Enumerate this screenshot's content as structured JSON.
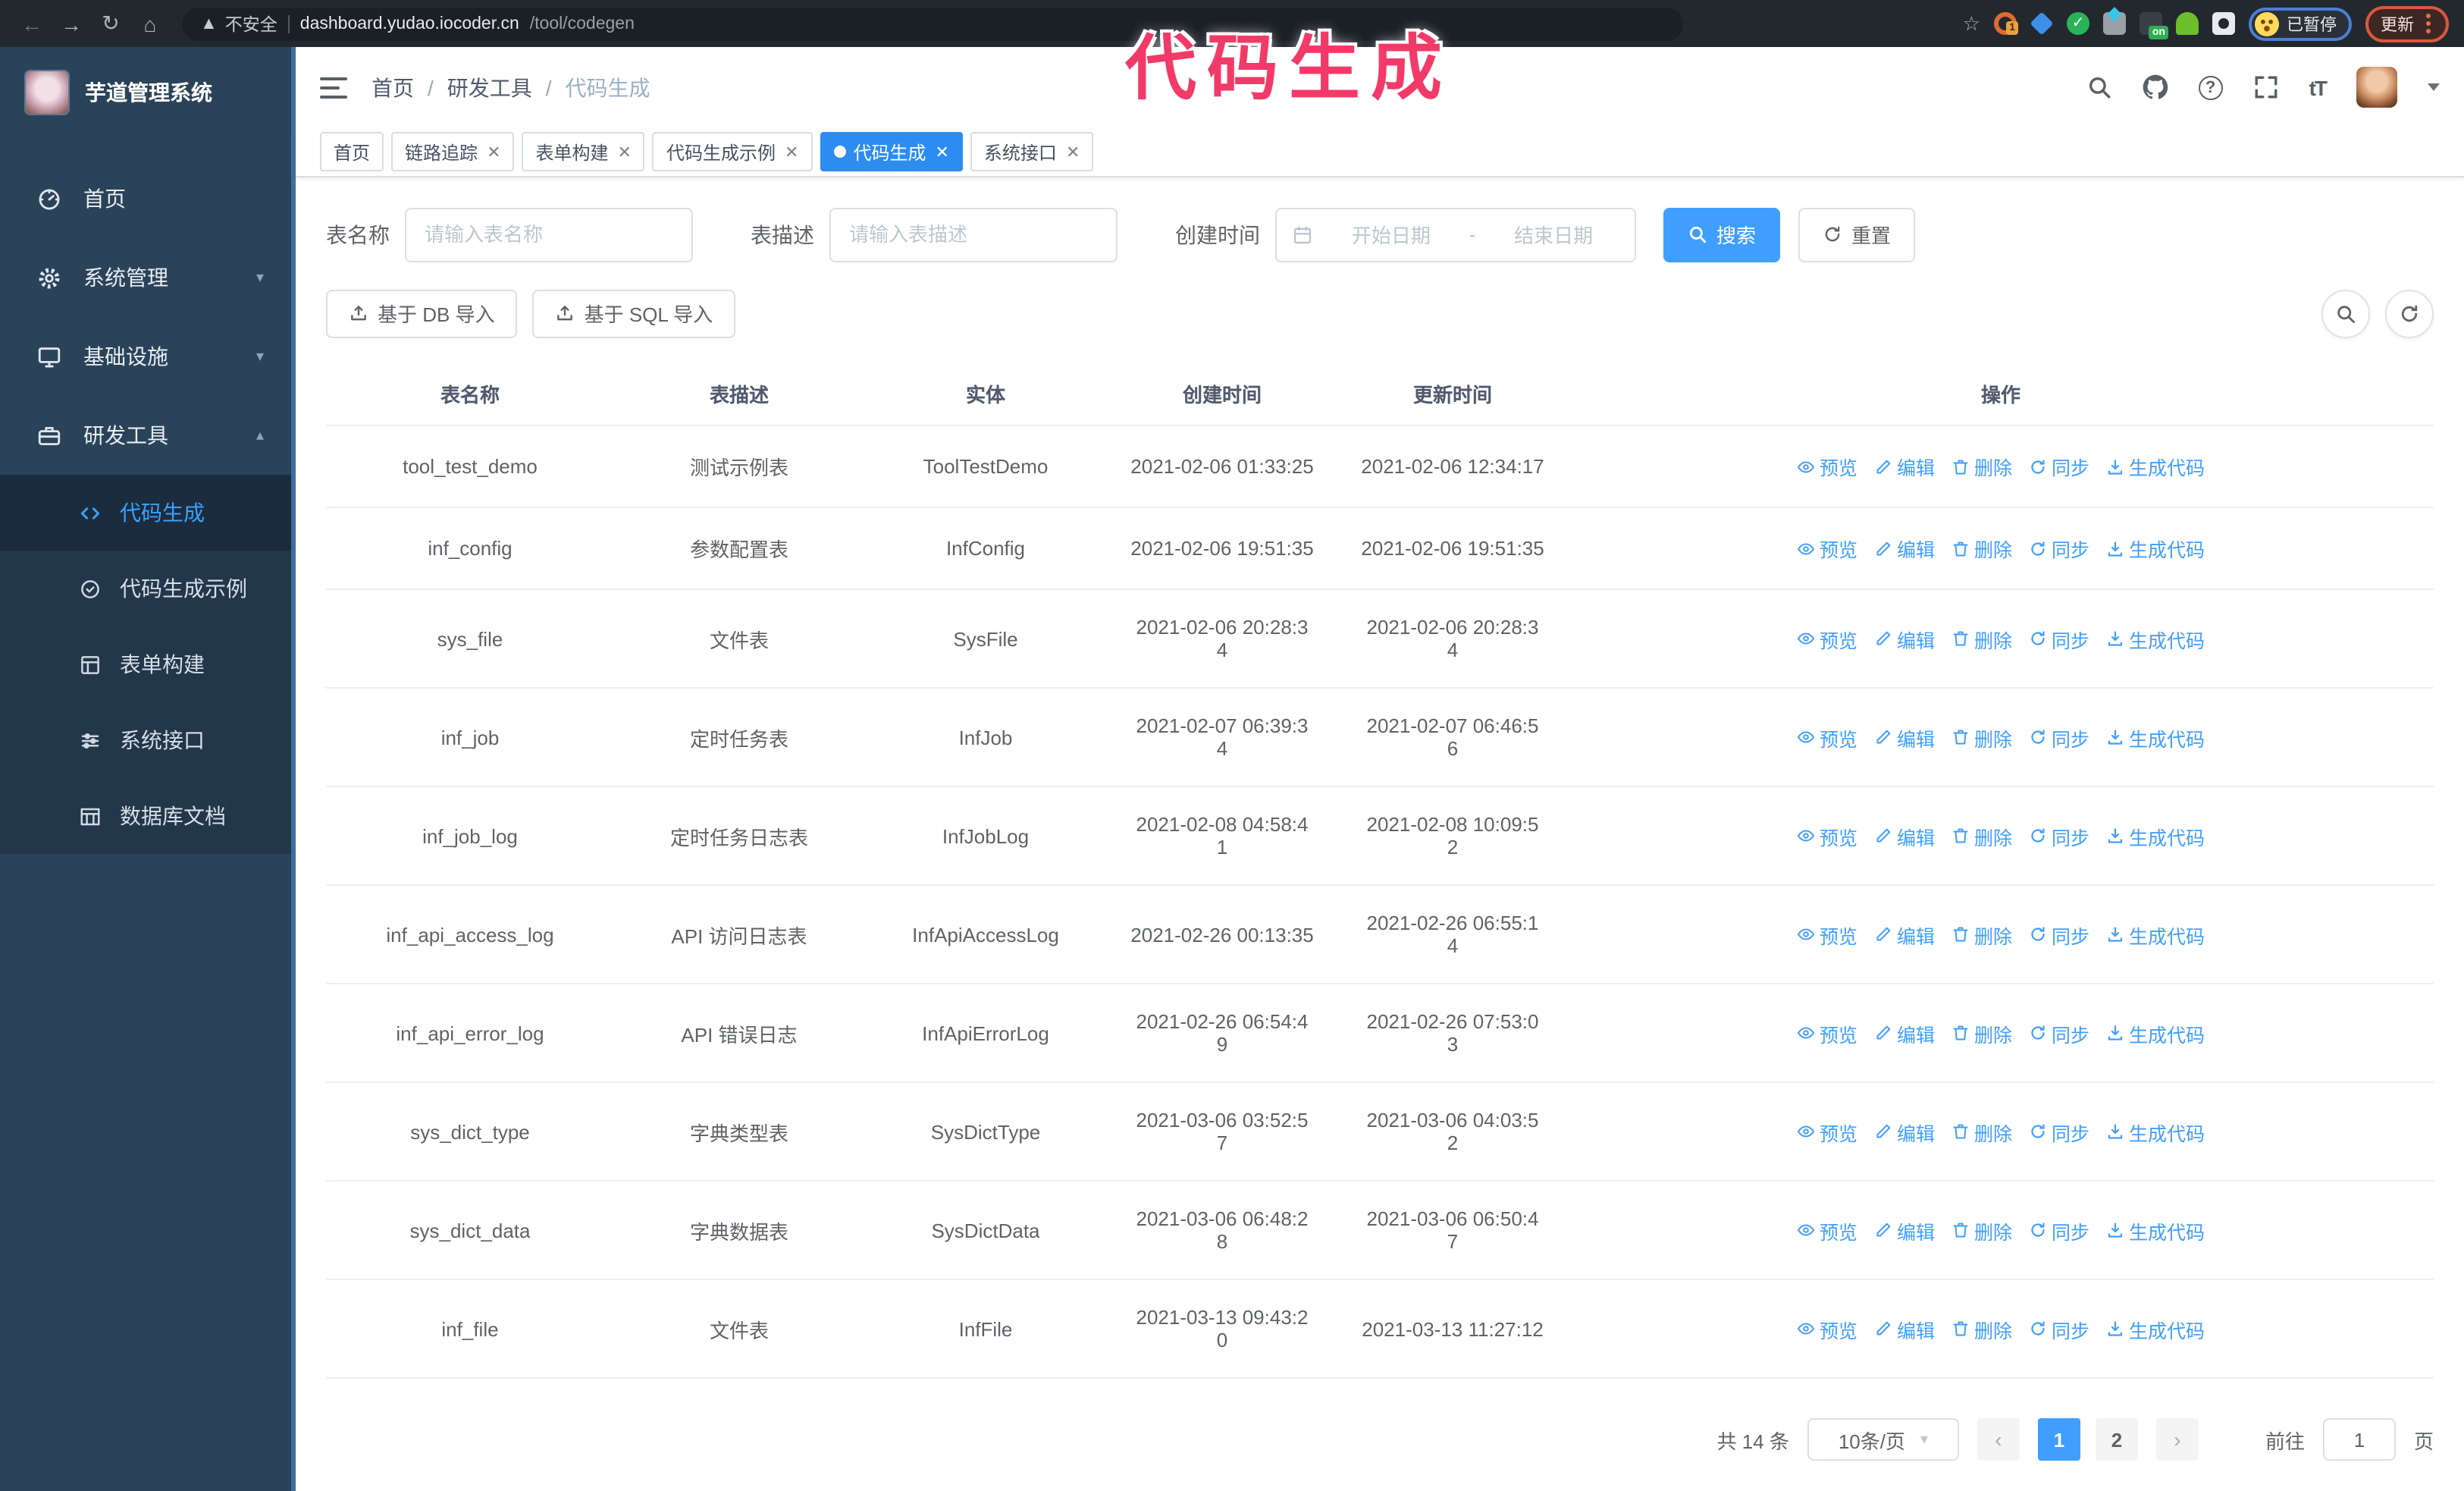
{
  "colors": {
    "accent": "#409eff",
    "tag_active": "#2d8cf0",
    "sidebar_bg": "#2a4359",
    "submenu_bg": "#223749",
    "annotation_pink": "#f23a68",
    "chrome_bg": "#23282f"
  },
  "chrome": {
    "security": "不安全",
    "host": "dashboard.yudao.iocoder.cn",
    "path": "/tool/codegen",
    "ext_badge": "1",
    "ext_on": "on",
    "paused_label": "已暂停",
    "update_label": "更新"
  },
  "annotation": {
    "text": "代码生成"
  },
  "sidebar": {
    "title": "芋道管理系统",
    "menu": [
      {
        "label": "首页",
        "icon": "dashboard-icon",
        "chevron": ""
      },
      {
        "label": "系统管理",
        "icon": "gear-icon",
        "chevron": "down"
      },
      {
        "label": "基础设施",
        "icon": "monitor-icon",
        "chevron": "down"
      },
      {
        "label": "研发工具",
        "icon": "toolbox-icon",
        "chevron": "up"
      }
    ],
    "submenu": [
      {
        "label": "代码生成",
        "icon": "code-icon",
        "active": true
      },
      {
        "label": "代码生成示例",
        "icon": "badge-check-icon",
        "active": false
      },
      {
        "label": "表单构建",
        "icon": "form-icon",
        "active": false
      },
      {
        "label": "系统接口",
        "icon": "sliders-icon",
        "active": false
      },
      {
        "label": "数据库文档",
        "icon": "db-table-icon",
        "active": false
      }
    ]
  },
  "header": {
    "breadcrumb": [
      "首页",
      "研发工具",
      "代码生成"
    ],
    "separator": "/"
  },
  "tabs": [
    {
      "label": "首页",
      "closable": false,
      "active": false
    },
    {
      "label": "链路追踪",
      "closable": true,
      "active": false
    },
    {
      "label": "表单构建",
      "closable": true,
      "active": false
    },
    {
      "label": "代码生成示例",
      "closable": true,
      "active": false
    },
    {
      "label": "代码生成",
      "closable": true,
      "active": true
    },
    {
      "label": "系统接口",
      "closable": true,
      "active": false
    }
  ],
  "filters": {
    "name_label": "表名称",
    "name_placeholder": "请输入表名称",
    "desc_label": "表描述",
    "desc_placeholder": "请输入表描述",
    "time_label": "创建时间",
    "start_placeholder": "开始日期",
    "range_separator": "-",
    "end_placeholder": "结束日期",
    "search_label": "搜索",
    "reset_label": "重置"
  },
  "toolbar": {
    "db_import_label": "基于 DB 导入",
    "sql_import_label": "基于 SQL 导入"
  },
  "table": {
    "columns": [
      "表名称",
      "表描述",
      "实体",
      "创建时间",
      "更新时间",
      "操作"
    ],
    "actions": [
      {
        "label": "预览",
        "icon": "eye-icon"
      },
      {
        "label": "编辑",
        "icon": "edit-icon"
      },
      {
        "label": "删除",
        "icon": "trash-icon"
      },
      {
        "label": "同步",
        "icon": "sync-icon"
      },
      {
        "label": "生成代码",
        "icon": "download-icon"
      }
    ],
    "rows": [
      {
        "name": "tool_test_demo",
        "desc": "测试示例表",
        "entity": "ToolTestDemo",
        "created": "2021-02-06 01:33:25",
        "updated": "2021-02-06 12:34:17"
      },
      {
        "name": "inf_config",
        "desc": "参数配置表",
        "entity": "InfConfig",
        "created": "2021-02-06 19:51:35",
        "updated": "2021-02-06 19:51:35"
      },
      {
        "name": "sys_file",
        "desc": "文件表",
        "entity": "SysFile",
        "created": "2021-02-06 20:28:3\n4",
        "updated": "2021-02-06 20:28:3\n4"
      },
      {
        "name": "inf_job",
        "desc": "定时任务表",
        "entity": "InfJob",
        "created": "2021-02-07 06:39:3\n4",
        "updated": "2021-02-07 06:46:5\n6"
      },
      {
        "name": "inf_job_log",
        "desc": "定时任务日志表",
        "entity": "InfJobLog",
        "created": "2021-02-08 04:58:4\n1",
        "updated": "2021-02-08 10:09:5\n2"
      },
      {
        "name": "inf_api_access_log",
        "desc": "API 访问日志表",
        "entity": "InfApiAccessLog",
        "created": "2021-02-26 00:13:35",
        "updated": "2021-02-26 06:55:1\n4"
      },
      {
        "name": "inf_api_error_log",
        "desc": "API 错误日志",
        "entity": "InfApiErrorLog",
        "created": "2021-02-26 06:54:4\n9",
        "updated": "2021-02-26 07:53:0\n3"
      },
      {
        "name": "sys_dict_type",
        "desc": "字典类型表",
        "entity": "SysDictType",
        "created": "2021-03-06 03:52:5\n7",
        "updated": "2021-03-06 04:03:5\n2"
      },
      {
        "name": "sys_dict_data",
        "desc": "字典数据表",
        "entity": "SysDictData",
        "created": "2021-03-06 06:48:2\n8",
        "updated": "2021-03-06 06:50:4\n7"
      },
      {
        "name": "inf_file",
        "desc": "文件表",
        "entity": "InfFile",
        "created": "2021-03-13 09:43:2\n0",
        "updated": "2021-03-13 11:27:12"
      }
    ]
  },
  "pagination": {
    "total_label": "共 14 条",
    "page_size_label": "10条/页",
    "pages": [
      "1",
      "2"
    ],
    "active_page": "1",
    "goto_label": "前往",
    "goto_value": "1",
    "page_unit_label": "页"
  }
}
